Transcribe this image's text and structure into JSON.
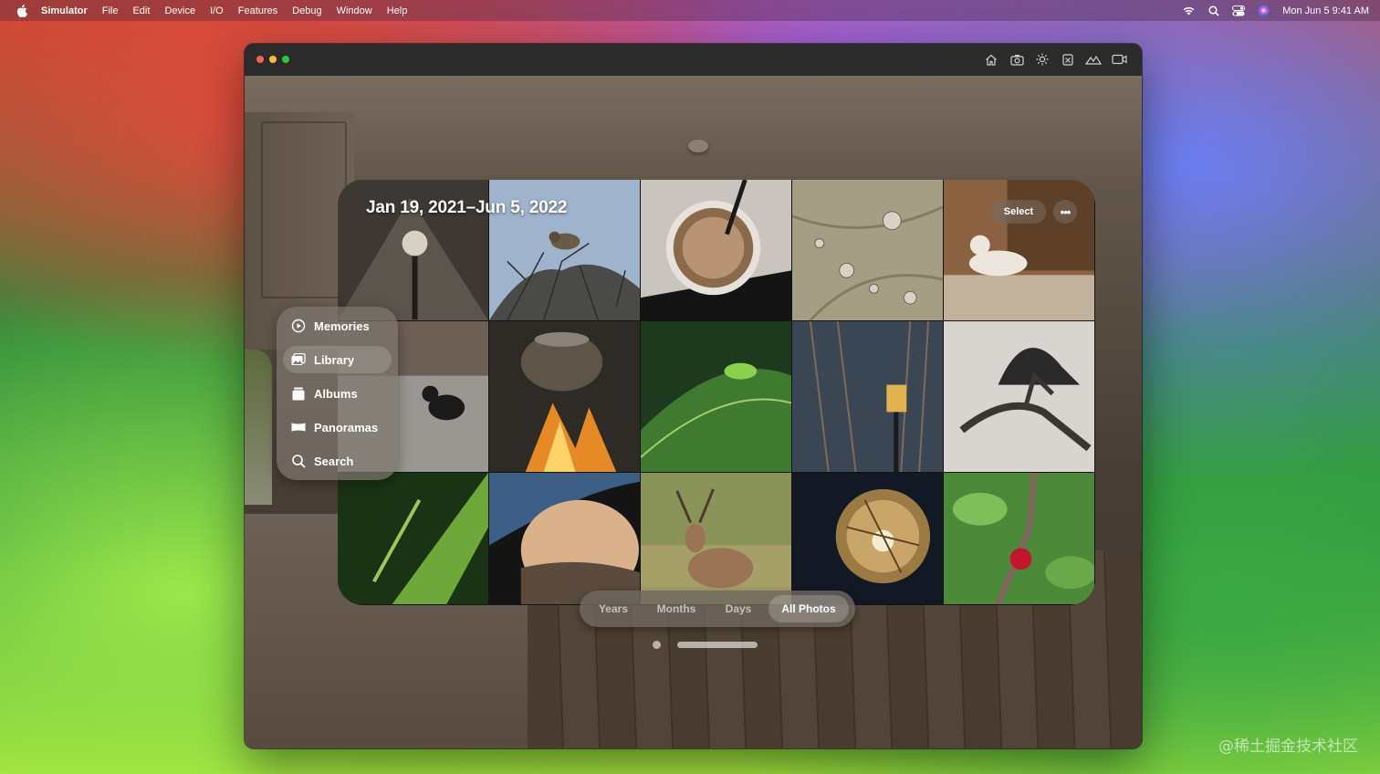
{
  "menubar": {
    "app": "Simulator",
    "items": [
      "File",
      "Edit",
      "Device",
      "I/O",
      "Features",
      "Debug",
      "Window",
      "Help"
    ],
    "datetime": "Mon Jun 5  9:41 AM"
  },
  "window": {
    "toolbar_icons": [
      "home-icon",
      "screenshot-icon",
      "brightness-icon",
      "rotate-icon",
      "environment-icon",
      "record-icon"
    ]
  },
  "photos": {
    "title": "Jan 19, 2021–Jun 5, 2022",
    "select_label": "Select",
    "more_label": "•••"
  },
  "sidebar": {
    "items": [
      {
        "label": "Memories",
        "icon": "memories-icon"
      },
      {
        "label": "Library",
        "icon": "library-icon",
        "active": true
      },
      {
        "label": "Albums",
        "icon": "albums-icon"
      },
      {
        "label": "Panoramas",
        "icon": "panoramas-icon"
      },
      {
        "label": "Search",
        "icon": "search-icon"
      }
    ]
  },
  "segmented": {
    "items": [
      "Years",
      "Months",
      "Days",
      "All Photos"
    ],
    "selected": "All Photos"
  },
  "watermark": "@稀土掘金技术社区",
  "colors": {
    "window_chrome": "#2b2b2b",
    "close": "#ff5f57",
    "minimize": "#febc2e",
    "zoom": "#28c840"
  }
}
